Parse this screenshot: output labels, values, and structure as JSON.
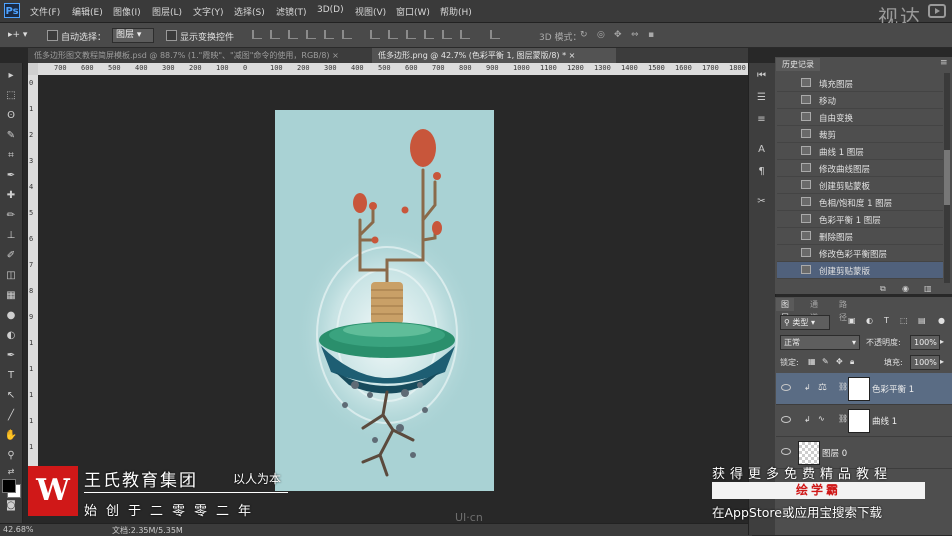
{
  "menubar": {
    "app_icon": "Ps",
    "items": [
      "文件(F)",
      "编辑(E)",
      "图像(I)",
      "图层(L)",
      "文字(Y)",
      "选择(S)",
      "滤镜(T)",
      "3D(D)",
      "视图(V)",
      "窗口(W)",
      "帮助(H)"
    ],
    "brand_watermark": "视达"
  },
  "options_bar": {
    "auto_select_label": "自动选择：",
    "auto_select_value": "图层",
    "show_transform_label": "显示变换控件",
    "mode_3d_label": "3D 模式："
  },
  "doc_tabs": [
    {
      "label": "低多边形图文教程简屏模板.psd @ 88.7% (1.\"霞映\"、\"减图\"命令的使用，RGB/8)",
      "active": false
    },
    {
      "label": "低多边形.png @ 42.7% (色彩平衡 1, 图层蒙版/8) *",
      "active": true
    }
  ],
  "ruler": {
    "h_labels": [
      "700",
      "600",
      "500",
      "400",
      "300",
      "200",
      "100",
      "0",
      "100",
      "200",
      "300",
      "400",
      "500",
      "600",
      "700",
      "800",
      "900",
      "1000",
      "1100",
      "1200",
      "1300",
      "1400",
      "1500",
      "1600",
      "1700",
      "1800"
    ],
    "v_labels": [
      "0",
      "1",
      "2",
      "3",
      "4",
      "5",
      "6",
      "7",
      "8",
      "9",
      "1",
      "1",
      "1",
      "1",
      "1",
      "1"
    ]
  },
  "status": {
    "zoom": "42.68%",
    "doc": "文档:2.35M/5.35M"
  },
  "history": {
    "tab": "历史记录",
    "items": [
      {
        "label": "填充图层",
        "icon": "layer-fill-icon"
      },
      {
        "label": "移动",
        "icon": "move-tool-icon"
      },
      {
        "label": "自由变换",
        "icon": "history-state-icon"
      },
      {
        "label": "裁剪",
        "icon": "crop-icon"
      },
      {
        "label": "曲线 1 图层",
        "icon": "history-state-icon"
      },
      {
        "label": "修改曲线图层",
        "icon": "history-state-icon"
      },
      {
        "label": "创建剪贴蒙板",
        "icon": "history-state-icon"
      },
      {
        "label": "色相/饱和度 1 图层",
        "icon": "history-state-icon"
      },
      {
        "label": "色彩平衡 1 图层",
        "icon": "history-state-icon"
      },
      {
        "label": "删除图层",
        "icon": "history-state-icon"
      },
      {
        "label": "修改色彩平衡图层",
        "icon": "history-state-icon"
      },
      {
        "label": "创建剪贴蒙版",
        "icon": "history-state-icon"
      }
    ]
  },
  "layers": {
    "tabs": [
      "图层",
      "通道",
      "路径"
    ],
    "filter_kind": "类型",
    "blend_mode": "正常",
    "opacity_label": "不透明度:",
    "opacity_value": "100%",
    "lock_label": "锁定:",
    "fill_label": "填充:",
    "fill_value": "100%",
    "items": [
      {
        "name": "色彩平衡 1",
        "selected": true
      },
      {
        "name": "曲线 1",
        "selected": false
      },
      {
        "name": "图层 0",
        "selected": false
      }
    ]
  },
  "watermark": {
    "logo_letter": "W",
    "title": "王氏教育集团",
    "slogan": "以人为本",
    "founded": "始创于二零零二年",
    "promo_line1": "获得更多免费精品教程",
    "promo_line2": "绘学霸",
    "promo_line3": "在AppStore或应用宝搜索下载",
    "site": "UI·cn"
  },
  "colors": {
    "canvas_bg": "#a9d2d4",
    "accent_selected": "#50617c",
    "brand_red": "#d01818"
  }
}
